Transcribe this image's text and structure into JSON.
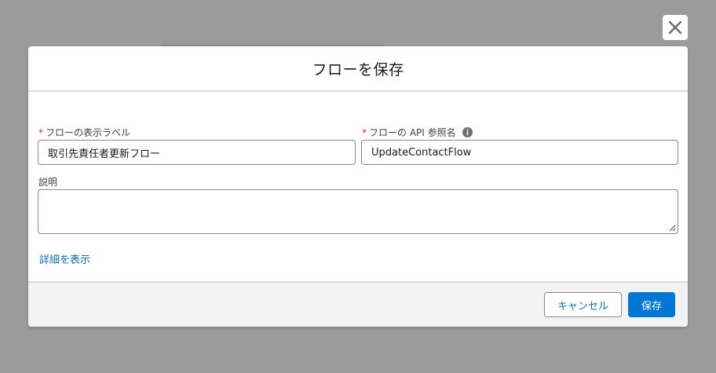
{
  "modal": {
    "title": "フローを保存",
    "close_icon": "close-icon"
  },
  "form": {
    "label_field": {
      "label": "フローの表示ラベル",
      "required_mark": "*",
      "value": "取引先責任者更新フロー"
    },
    "api_name_field": {
      "label": "フローの API 参照名",
      "required_mark": "*",
      "value": "UpdateContactFlow",
      "info_icon": "info-icon"
    },
    "description_field": {
      "label": "説明",
      "value": ""
    },
    "show_details_link": "詳細を表示"
  },
  "footer": {
    "cancel_label": "キャンセル",
    "save_label": "保存"
  },
  "colors": {
    "brand": "#0176d3",
    "link": "#0b6fc3",
    "required": "#c23934",
    "overlay": "#9b9b9b"
  }
}
